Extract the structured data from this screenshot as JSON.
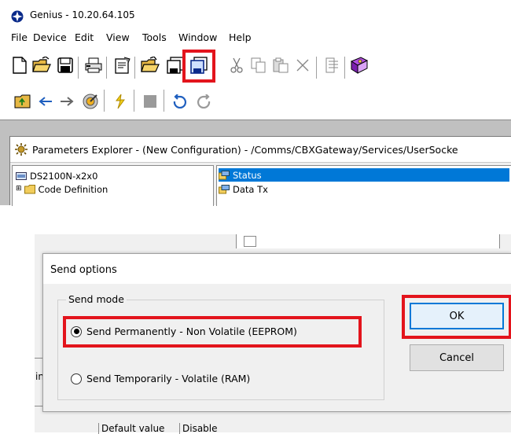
{
  "app": {
    "title": "Genius - 10.20.64.105"
  },
  "menu": {
    "items": [
      {
        "label": "File",
        "name": "menu-file"
      },
      {
        "label": "Device",
        "name": "menu-device"
      },
      {
        "label": "Edit",
        "name": "menu-edit"
      },
      {
        "label": "View",
        "name": "menu-view"
      },
      {
        "label": "Tools",
        "name": "menu-tools"
      },
      {
        "label": "Window",
        "name": "menu-window"
      },
      {
        "label": "Help",
        "name": "menu-help"
      }
    ]
  },
  "toolbar1": {
    "icons": [
      "new-file-icon",
      "open-folder-icon",
      "save-icon",
      "print-icon",
      "properties-icon",
      "open-configuration-icon",
      "save-configuration-icon",
      "send-configuration-icon",
      "cut-icon",
      "copy-icon",
      "paste-icon",
      "delete-icon",
      "align-icon",
      "help-book-icon"
    ],
    "highlighted_icon": "send-configuration-icon"
  },
  "toolbar2": {
    "icons": [
      "up-folder-icon",
      "back-arrow-icon",
      "forward-arrow-icon",
      "capture-icon",
      "refresh-icon",
      "stop-icon",
      "undo-icon",
      "redo-icon"
    ]
  },
  "explorer": {
    "caption": "Parameters Explorer - (New Configuration) - /Comms/CBXGateway/Services/UserSocke",
    "tree": [
      {
        "label": "DS2100N-x2x0",
        "expander": ""
      },
      {
        "label": "Code Definition",
        "expander": "⊞"
      }
    ],
    "list": [
      {
        "label": "Status",
        "selected": true
      },
      {
        "label": "Data Tx",
        "selected": false
      }
    ]
  },
  "dialog": {
    "title": "Send options",
    "group_label": "Send mode",
    "options": [
      {
        "label": "Send Permanently - Non Volatile (EEPROM)",
        "checked": true
      },
      {
        "label": "Send Temporarily - Volatile (RAM)",
        "checked": false
      }
    ],
    "ok_label": "OK",
    "cancel_label": "Cancel"
  },
  "background_window": {
    "left_fragment": "in",
    "default_label": "Default value",
    "default_value": "Disable"
  },
  "colors": {
    "highlight": "#e3141c",
    "selection": "#0078d7",
    "window_bg": "#f0f0f0"
  }
}
